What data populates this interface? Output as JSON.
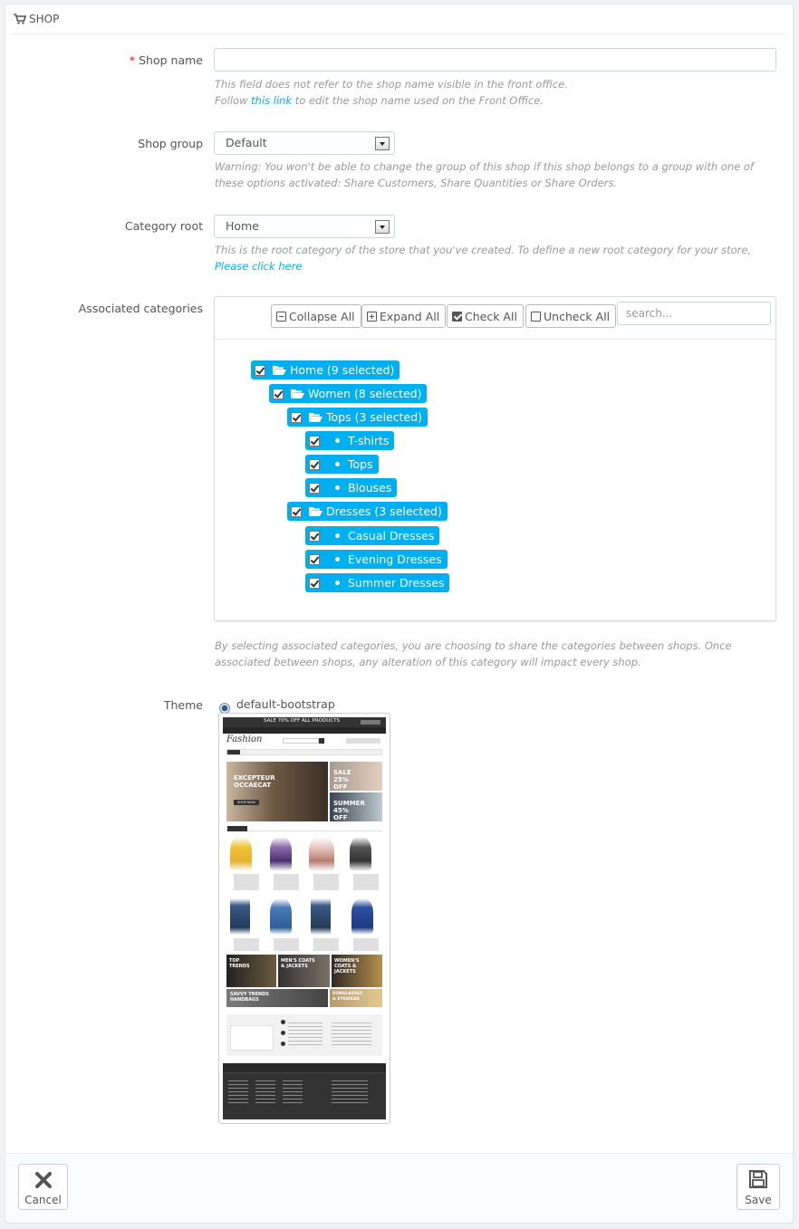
{
  "panel": {
    "title": "SHOP",
    "icon": "cart-icon"
  },
  "shop_name": {
    "required_mark": "*",
    "label": "Shop name",
    "value": "",
    "help_line1": "This field does not refer to the shop name visible in the front office.",
    "help_prefix": "Follow ",
    "help_link": "this link",
    "help_suffix": " to edit the shop name used on the Front Office."
  },
  "shop_group": {
    "label": "Shop group",
    "selected": "Default",
    "help": "Warning: You won't be able to change the group of this shop if this shop belongs to a group with one of these options activated: Share Customers, Share Quantities or Share Orders."
  },
  "category_root": {
    "label": "Category root",
    "selected": "Home",
    "help_prefix": "This is the root category of the store that you've created. To define a new root category for your store, ",
    "help_link": "Please click here"
  },
  "associated_categories": {
    "label": "Associated categories",
    "toolbar": {
      "collapse_all": "Collapse All",
      "expand_all": "Expand All",
      "check_all": "Check All",
      "uncheck_all": "Uncheck All",
      "search_placeholder": "search..."
    },
    "tree": [
      {
        "label": "Home (9 selected)",
        "kind": "folder",
        "checked": true
      },
      {
        "label": "Women (8 selected)",
        "kind": "folder",
        "checked": true
      },
      {
        "label": "Tops (3 selected)",
        "kind": "folder",
        "checked": true
      },
      {
        "label": "T-shirts",
        "kind": "leaf",
        "checked": true
      },
      {
        "label": "Tops",
        "kind": "leaf",
        "checked": true
      },
      {
        "label": "Blouses",
        "kind": "leaf",
        "checked": true
      },
      {
        "label": "Dresses (3 selected)",
        "kind": "folder",
        "checked": true
      },
      {
        "label": "Casual Dresses",
        "kind": "leaf",
        "checked": true
      },
      {
        "label": "Evening Dresses",
        "kind": "leaf",
        "checked": true
      },
      {
        "label": "Summer Dresses",
        "kind": "leaf",
        "checked": true
      }
    ],
    "help": "By selecting associated categories, you are choosing to share the categories between shops. Once associated between shops, any alteration of this category will impact every shop."
  },
  "theme": {
    "label": "Theme",
    "option": "default-bootstrap",
    "selected": true,
    "preview": {
      "banner": "SALE 70% OFF ALL PRODUCTS",
      "logo": "Fashion",
      "hero_title": "EXCEPTEUR OCCAECAT",
      "hero_button": "SHOP NOW",
      "promo1": "SALE 25% OFF",
      "promo2": "SUMMER 45% OFF",
      "tile1": "TOP TRENDS",
      "tile2": "MEN'S COATS & JACKETS",
      "tile3": "WOMEN'S COATS & JACKETS",
      "tile4": "SAVVY TRENDS HANDBAGS",
      "tile5": "SUNGLASSES & EYEWEAR"
    }
  },
  "footer": {
    "cancel_label": "Cancel",
    "save_label": "Save"
  },
  "colors": {
    "accent": "#00aff0",
    "required": "#ee0000",
    "help_text": "#999999"
  }
}
